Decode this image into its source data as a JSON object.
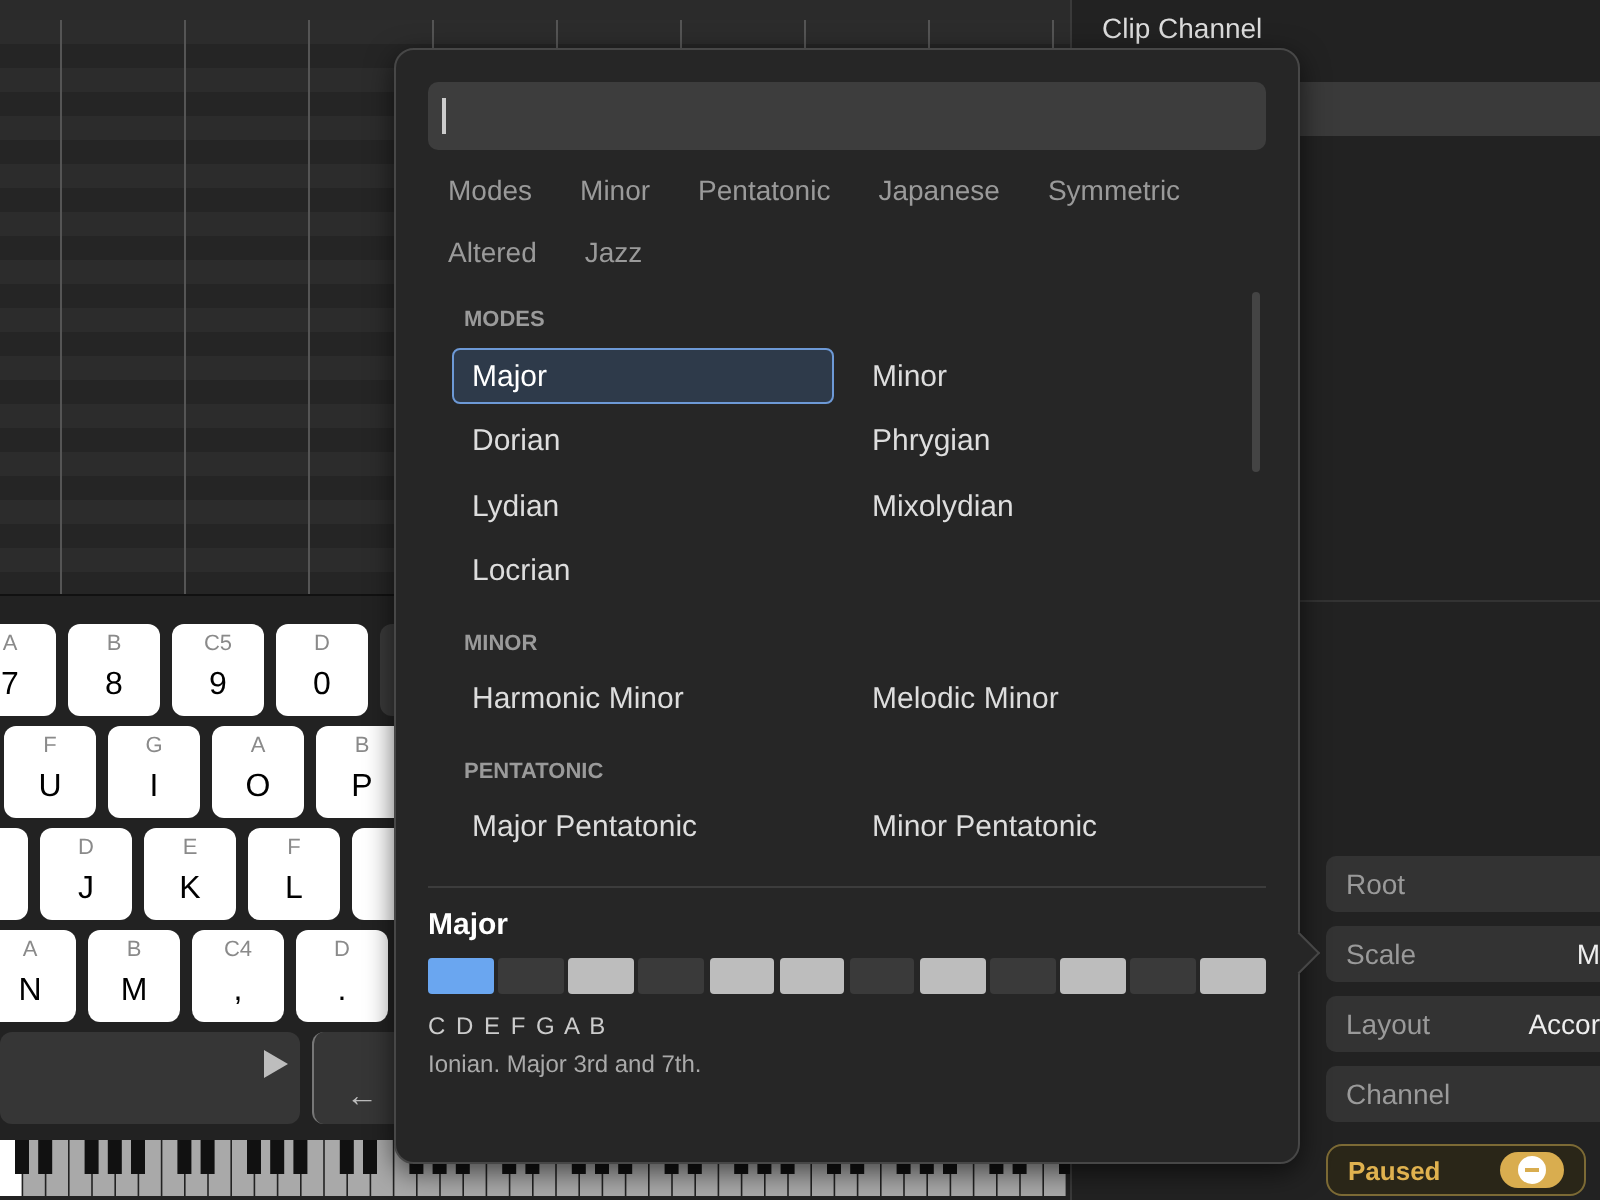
{
  "keyboard": {
    "rows": [
      {
        "keys": [
          {
            "kind": "light",
            "note": "A",
            "key": "7"
          },
          {
            "kind": "light",
            "note": "B",
            "key": "8"
          },
          {
            "kind": "light",
            "note": "C5",
            "key": "9"
          },
          {
            "kind": "light",
            "note": "D",
            "key": "0"
          },
          {
            "kind": "dark"
          }
        ]
      },
      {
        "keys": [
          {
            "kind": "light",
            "note": "F",
            "key": "U"
          },
          {
            "kind": "light",
            "note": "G",
            "key": "I"
          },
          {
            "kind": "light",
            "note": "A",
            "key": "O"
          },
          {
            "kind": "light",
            "note": "B",
            "key": "P"
          }
        ]
      },
      {
        "keys": [
          {
            "kind": "light"
          },
          {
            "kind": "light",
            "note": "D",
            "key": "J"
          },
          {
            "kind": "light",
            "note": "E",
            "key": "K"
          },
          {
            "kind": "light",
            "note": "F",
            "key": "L"
          },
          {
            "kind": "light"
          }
        ]
      },
      {
        "keys": [
          {
            "kind": "light",
            "note": "A",
            "key": "N"
          },
          {
            "kind": "light",
            "note": "B",
            "key": "M"
          },
          {
            "kind": "light",
            "note": "C4",
            "key": ","
          },
          {
            "kind": "light",
            "note": "D",
            "key": "."
          }
        ]
      }
    ],
    "octave_key": "←"
  },
  "right_panel": {
    "title": "Clip Channel",
    "settings": [
      {
        "label": "Root"
      },
      {
        "label": "Scale",
        "value": "M"
      },
      {
        "label": "Layout",
        "value": "Accor"
      },
      {
        "label": "Channel"
      }
    ],
    "status": {
      "label": "Paused"
    }
  },
  "popover": {
    "categories": [
      "Modes",
      "Minor",
      "Pentatonic",
      "Japanese",
      "Symmetric",
      "Altered",
      "Jazz"
    ],
    "sections": [
      {
        "title": "MODES",
        "items": [
          {
            "label": "Major",
            "selected": true
          },
          {
            "label": "Minor",
            "selected": false
          },
          {
            "label": "Dorian",
            "selected": false
          },
          {
            "label": "Phrygian",
            "selected": false
          },
          {
            "label": "Lydian",
            "selected": false
          },
          {
            "label": "Mixolydian",
            "selected": false
          },
          {
            "label": "Locrian",
            "selected": false
          }
        ]
      },
      {
        "title": "MINOR",
        "items": [
          {
            "label": "Harmonic Minor",
            "selected": false
          },
          {
            "label": "Melodic Minor",
            "selected": false
          }
        ]
      },
      {
        "title": "PENTATONIC",
        "items": [
          {
            "label": "Major Pentatonic",
            "selected": false
          },
          {
            "label": "Minor Pentatonic",
            "selected": false
          }
        ]
      }
    ],
    "detail": {
      "title": "Major",
      "cells": [
        {
          "kind": "root"
        },
        {
          "kind": "off"
        },
        {
          "kind": "on"
        },
        {
          "kind": "off"
        },
        {
          "kind": "on"
        },
        {
          "kind": "on"
        },
        {
          "kind": "off"
        },
        {
          "kind": "on"
        },
        {
          "kind": "off"
        },
        {
          "kind": "on"
        },
        {
          "kind": "off"
        },
        {
          "kind": "on"
        }
      ],
      "notes": "C D E F G A B",
      "description": "Ionian. Major 3rd and 7th."
    }
  }
}
